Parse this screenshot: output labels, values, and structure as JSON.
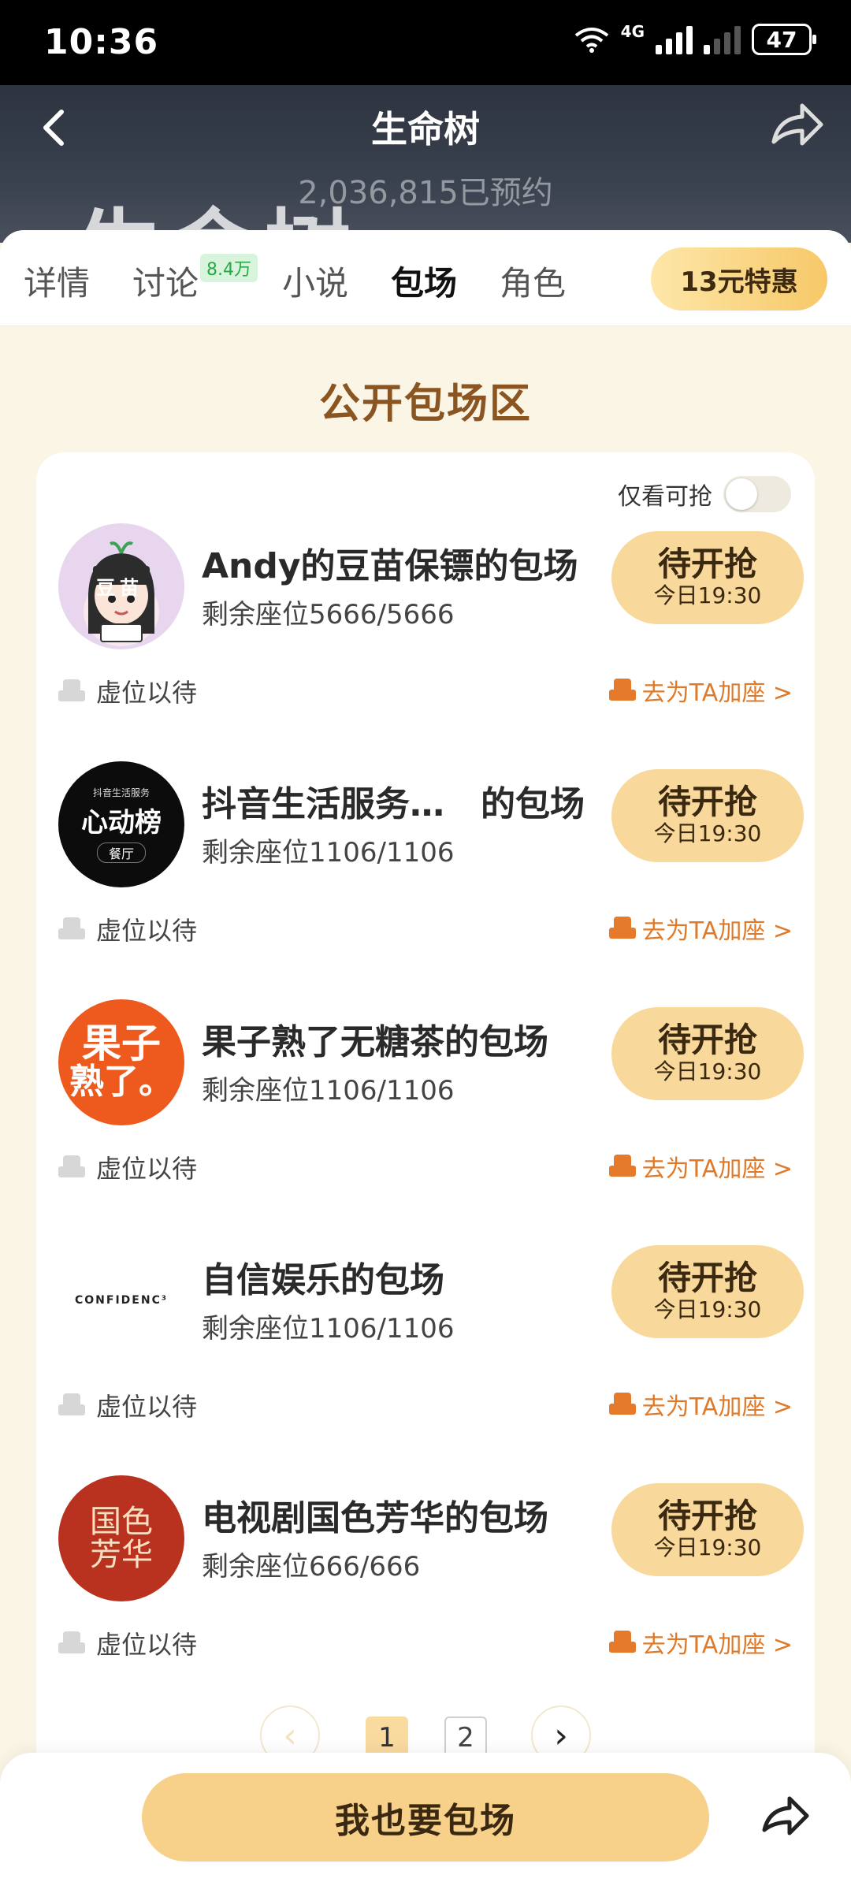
{
  "status_bar": {
    "time": "10:36",
    "network": "4G",
    "battery": "47"
  },
  "header": {
    "title": "生命树",
    "background_title": "生命树",
    "reservations": "2,036,815已预约"
  },
  "tabs": [
    {
      "label": "详情"
    },
    {
      "label": "讨论"
    },
    {
      "label": "小说"
    },
    {
      "label": "包场"
    },
    {
      "label": "角色"
    }
  ],
  "discussion_badge": "8.4万",
  "promo_label": "13元特惠",
  "section_title": "公开包场区",
  "filter_label": "仅看可抢",
  "screenings": [
    {
      "title": "Andy的豆苗保镖的包场",
      "seats": "剩余座位5666/5666",
      "button": "待开抢",
      "time": "今日19:30",
      "wait": "虚位以待",
      "add": "去为TA加座 >"
    },
    {
      "title": "抖音生活服务…   的包场",
      "seats": "剩余座位1106/1106",
      "button": "待开抢",
      "time": "今日19:30",
      "wait": "虚位以待",
      "add": "去为TA加座 >"
    },
    {
      "title": "果子熟了无糖茶的包场",
      "seats": "剩余座位1106/1106",
      "button": "待开抢",
      "time": "今日19:30",
      "wait": "虚位以待",
      "add": "去为TA加座 >"
    },
    {
      "title": "自信娱乐的包场",
      "seats": "剩余座位1106/1106",
      "button": "待开抢",
      "time": "今日19:30",
      "wait": "虚位以待",
      "add": "去为TA加座 >"
    },
    {
      "title": "电视剧国色芳华的包场",
      "seats": "剩余座位666/666",
      "button": "待开抢",
      "time": "今日19:30",
      "wait": "虚位以待",
      "add": "去为TA加座 >"
    }
  ],
  "avatars": {
    "a1_text": "豆苗",
    "a2_small": "抖音生活服务",
    "a2_main": "心动榜",
    "a2_sub": "餐厅",
    "a3_line1": "果子",
    "a3_line2": "熟了。",
    "a4_text": "CONFIDENC³",
    "a5_text": "国色芳华"
  },
  "pagination": {
    "pages": [
      "1",
      "2"
    ],
    "current": "1"
  },
  "cta_label": "我也要包场"
}
